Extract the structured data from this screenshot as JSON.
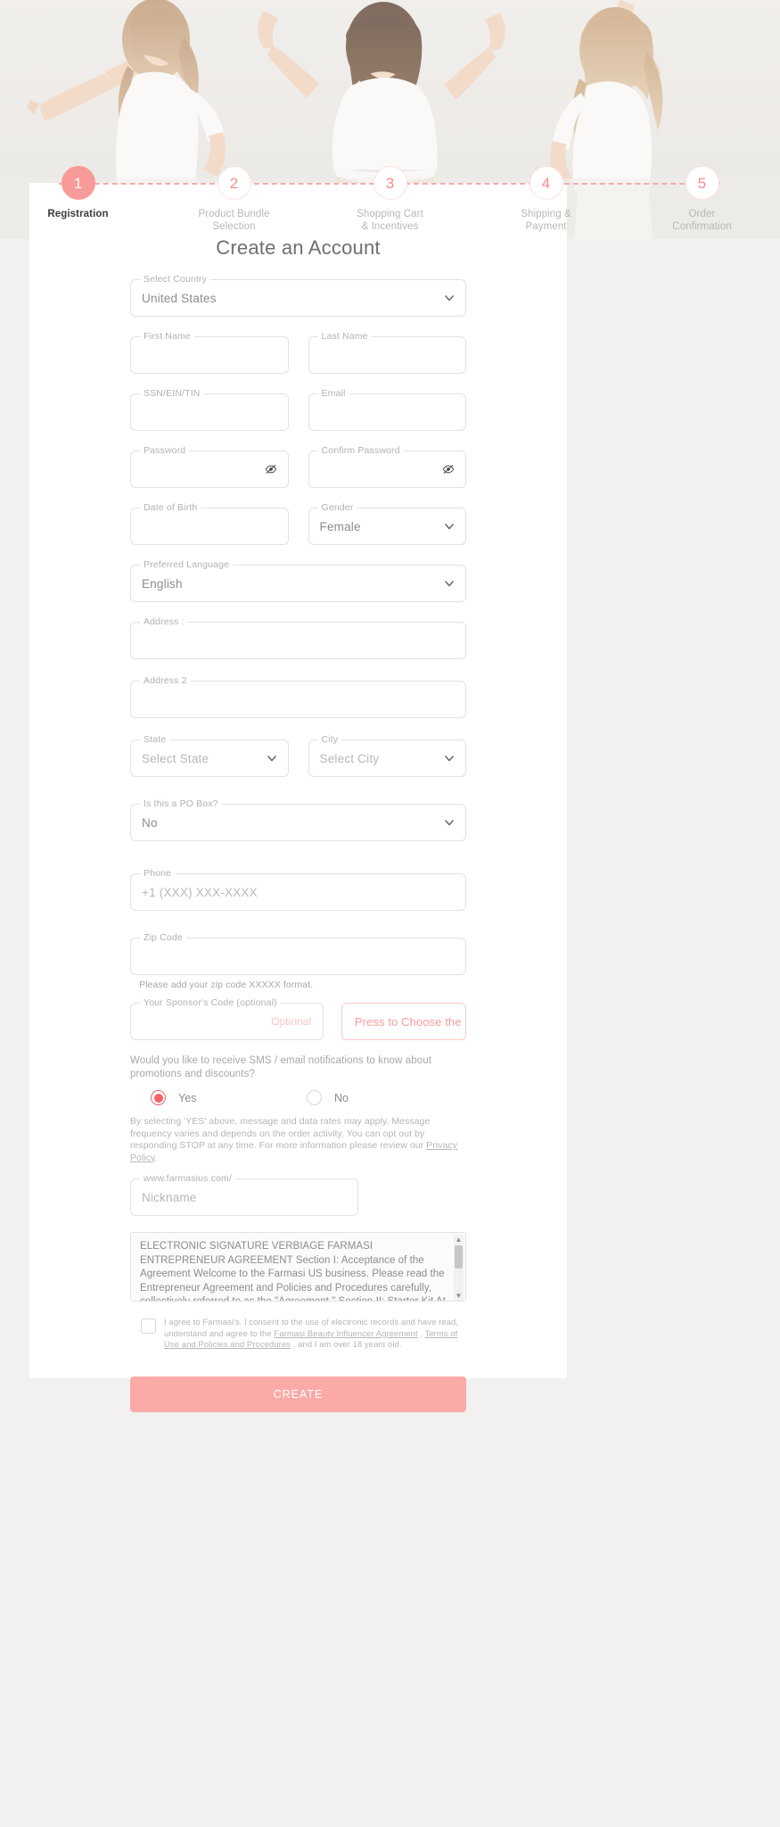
{
  "stepper": {
    "steps": [
      {
        "num": "1",
        "label": "Registration",
        "active": true
      },
      {
        "num": "2",
        "label": "Product Bundle\nSelection",
        "active": false
      },
      {
        "num": "3",
        "label": "Shopping Cart\n& Incentives",
        "active": false
      },
      {
        "num": "4",
        "label": "Shipping &\nPayment",
        "active": false
      },
      {
        "num": "5",
        "label": "Order\nConfirmation",
        "active": false
      }
    ]
  },
  "form": {
    "title": "Create an Account",
    "country": {
      "legend": "Select Country",
      "value": "United States"
    },
    "first_name": {
      "legend": "First Name",
      "value": ""
    },
    "last_name": {
      "legend": "Last Name",
      "value": ""
    },
    "ssn": {
      "legend": "SSN/EIN/TIN",
      "value": ""
    },
    "email": {
      "legend": "Email",
      "value": ""
    },
    "password": {
      "legend": "Password",
      "value": ""
    },
    "confirm_password": {
      "legend": "Confirm Password",
      "value": ""
    },
    "dob": {
      "legend": "Date of Birth",
      "value": ""
    },
    "gender": {
      "legend": "Gender",
      "value": "Female"
    },
    "language": {
      "legend": "Preferred Language",
      "value": "English"
    },
    "address": {
      "legend": "Address :",
      "value": ""
    },
    "address2": {
      "legend": "Address 2",
      "value": ""
    },
    "state": {
      "legend": "State",
      "value": "Select State"
    },
    "city": {
      "legend": "City",
      "value": "Select City"
    },
    "po_box": {
      "legend": "Is this a PO Box?",
      "value": "No"
    },
    "phone": {
      "legend": "Phone",
      "value": "+1 (XXX) XXX-XXXX"
    },
    "zip": {
      "legend": "Zip Code",
      "value": "",
      "helper": "Please add your zip code XXXXX format."
    },
    "sponsor": {
      "legend": "Your Sponsor's Code (optional)",
      "value": "",
      "tag": "Optional"
    },
    "choose_button": "Press to Choose the Sponsor",
    "sms_question": "Would you like to receive SMS / email notifications to know about promotions and discounts?",
    "radio_yes": "Yes",
    "radio_no": "No",
    "sms_legal_1": "By selecting 'YES' above, message and data rates may apply. Message frequency varies and depends on the order activity. You can opt out by responding STOP at any time. For more information please review our ",
    "sms_legal_link": "Privacy Policy",
    "sms_legal_2": ".",
    "nickname": {
      "legend": "www.farmasius.com/",
      "value": "Nickname"
    },
    "agreement_text": "ELECTRONIC SIGNATURE VERBIAGE FARMASI ENTREPRENEUR AGREEMENT Section I: Acceptance of the Agreement Welcome to the Farmasi US business. Please read the Entrepreneur Agreement and Policies and Procedures carefully, collectively referred to as the \"Agreement.\" Section II: Starter Kit At the time of enrollment, you",
    "consent_1": "I agree to Farmasi's. I consent to the use of electronic records and have read, understand and agree to the ",
    "consent_link_1": "Farmasi Beauty Influencer Agreement",
    "consent_mid": " , ",
    "consent_link_2": "Terms of Use and Policies and Procedures",
    "consent_2": " , and I am over 18 years old.",
    "create_label": "CREATE"
  },
  "colors": {
    "accent": "#f99a9a",
    "accent_strong": "#f4626a",
    "button": "#fcaaa7",
    "border": "#e4e2e0",
    "text_muted": "#b3b1b0"
  }
}
